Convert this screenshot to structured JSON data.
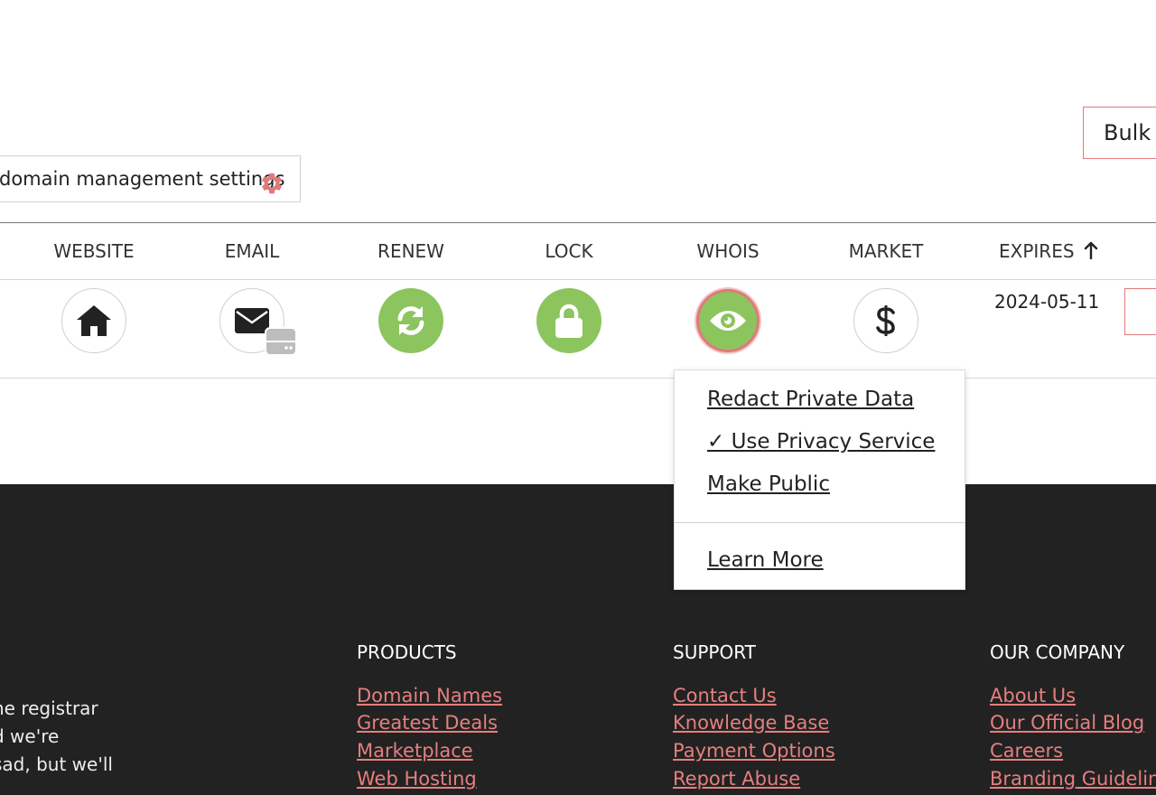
{
  "toolbar": {
    "bulk_label": "Bulk",
    "settings_label": "domain management settings"
  },
  "table": {
    "columns": [
      {
        "label": "WEBSITE",
        "icon": "home-icon"
      },
      {
        "label": "EMAIL",
        "icon": "envelope-icon"
      },
      {
        "label": "RENEW",
        "icon": "refresh-icon"
      },
      {
        "label": "LOCK",
        "icon": "lock-icon"
      },
      {
        "label": "WHOIS",
        "icon": "eye-icon"
      },
      {
        "label": "MARKET",
        "icon": "dollar-icon"
      }
    ],
    "expires_label": "EXPIRES",
    "sort_icon": "arrow-up-icon",
    "rows": [
      {
        "expires": "2024-05-11"
      }
    ]
  },
  "whois_menu": {
    "items": [
      {
        "label": "Redact Private Data"
      },
      {
        "label": "✓ Use Privacy Service"
      },
      {
        "label": "Make Public"
      }
    ],
    "learn_more": "Learn More"
  },
  "footer": {
    "tagline_lines": [
      "ne registrar",
      "d we're",
      " sad, but we'll"
    ],
    "columns": [
      {
        "heading": "PRODUCTS",
        "links": [
          "Domain Names",
          "Greatest Deals",
          "Marketplace",
          "Web Hosting"
        ]
      },
      {
        "heading": "SUPPORT",
        "links": [
          "Contact Us",
          "Knowledge Base",
          "Payment Options",
          "Report Abuse"
        ]
      },
      {
        "heading": "OUR COMPANY",
        "links": [
          "About Us",
          "Our Official Blog",
          "Careers",
          "Branding Guidelines"
        ]
      }
    ]
  },
  "colors": {
    "accent": "#e07a7a",
    "green": "#8cc45e",
    "footer_bg": "#222222",
    "footer_link": "#e57f7f"
  }
}
